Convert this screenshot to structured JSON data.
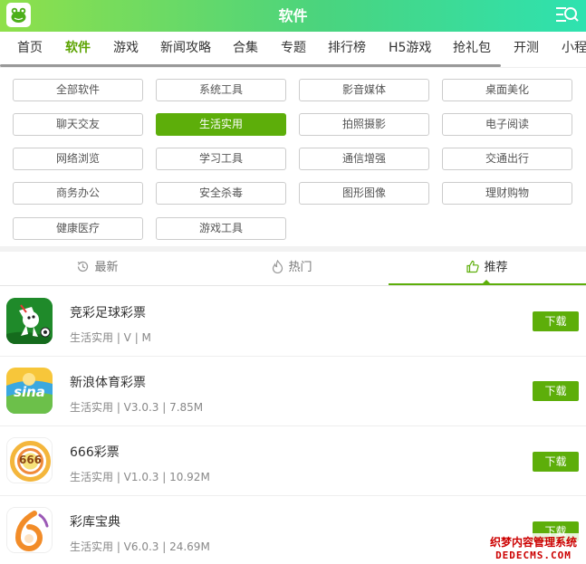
{
  "header": {
    "title": "软件"
  },
  "nav": {
    "items": [
      "首页",
      "软件",
      "游戏",
      "新闻攻略",
      "合集",
      "专题",
      "排行榜",
      "H5游戏",
      "抢礼包",
      "开测",
      "小程"
    ],
    "active_index": 1
  },
  "categories": [
    "全部软件",
    "系统工具",
    "影音媒体",
    "桌面美化",
    "聊天交友",
    "生活实用",
    "拍照摄影",
    "电子阅读",
    "网络浏览",
    "学习工具",
    "通信增强",
    "交通出行",
    "商务办公",
    "安全杀毒",
    "图形图像",
    "理财购物",
    "健康医疗",
    "游戏工具"
  ],
  "active_category_index": 5,
  "tabs": {
    "latest": "最新",
    "hot": "热门",
    "recommend": "推荐"
  },
  "apps": [
    {
      "name": "竞彩足球彩票",
      "meta": "生活实用 | V | M",
      "button": "下载"
    },
    {
      "name": "新浪体育彩票",
      "meta": "生活实用 | V3.0.3 | 7.85M",
      "button": "下载"
    },
    {
      "name": "666彩票",
      "meta": "生活实用 | V1.0.3 | 10.92M",
      "button": "下载"
    },
    {
      "name": "彩库宝典",
      "meta": "生活实用 | V6.0.3 | 24.69M",
      "button": "下载"
    }
  ],
  "icon_text": {
    "sina": "sina",
    "n666": "666"
  },
  "watermark": {
    "line1": "织梦内容管理系统",
    "line2": "DEDECMS.COM"
  },
  "colors": {
    "accent": "#5dae0a",
    "header_start": "#8fe04a",
    "header_end": "#2ee2b0"
  }
}
